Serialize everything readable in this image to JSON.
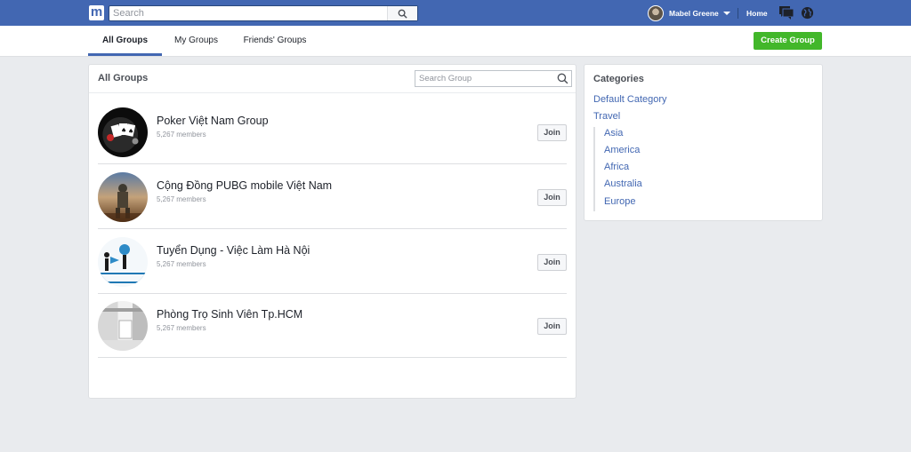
{
  "topbar": {
    "logo": "m",
    "search_placeholder": "Search",
    "user_name": "Mabel Greene",
    "home_label": "Home"
  },
  "tabs": [
    {
      "label": "All Groups",
      "active": true
    },
    {
      "label": "My Groups",
      "active": false
    },
    {
      "label": "Friends' Groups",
      "active": false
    }
  ],
  "create_group_label": "Create Group",
  "main": {
    "title": "All Groups",
    "search_placeholder": "Search Group",
    "groups": [
      {
        "name": "Poker Việt Nam Group",
        "members": "5,267 members",
        "join_label": "Join"
      },
      {
        "name": "Cộng Đồng PUBG mobile Việt Nam",
        "members": "5,267 members",
        "join_label": "Join"
      },
      {
        "name": "Tuyển Dụng - Việc Làm Hà Nội",
        "members": "5,267 members",
        "join_label": "Join"
      },
      {
        "name": "Phòng Trọ Sinh Viên Tp.HCM",
        "members": "5,267 members",
        "join_label": "Join"
      }
    ]
  },
  "categories": {
    "title": "Categories",
    "items": [
      "Default Category",
      "Travel"
    ],
    "sub_items": [
      "Asia",
      "America",
      "Africa",
      "Australia",
      "Europe"
    ]
  },
  "colors": {
    "brand": "#4267b2",
    "create_button": "#42b72a",
    "link": "#4267b2"
  }
}
